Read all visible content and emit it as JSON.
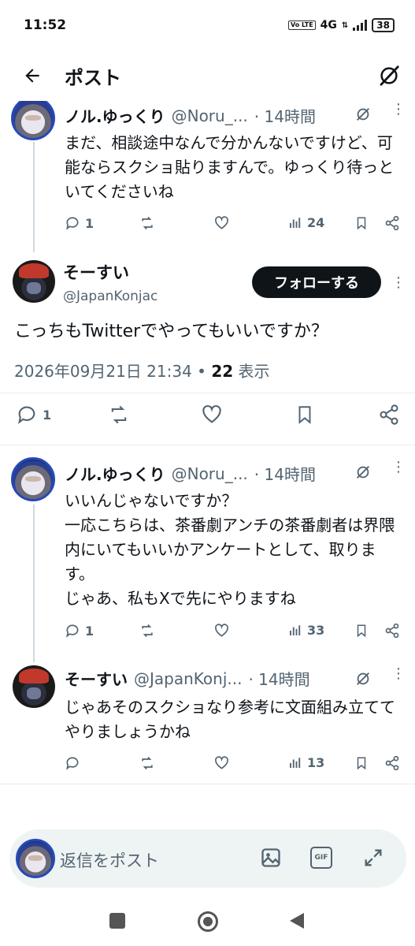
{
  "status_bar": {
    "time": "11:52",
    "network": "4G",
    "volte": "Vo LTE",
    "battery": "38"
  },
  "header": {
    "title": "ポスト"
  },
  "tweets": [
    {
      "name": "ノル.ゆっくり",
      "handle": "@Noru_...",
      "time": "· 14時間",
      "text": "まだ、相談途中なんで分かんないですけど、可能ならスクショ貼りますんで。ゆっくり待っといてくださいね",
      "replies": "1",
      "views": "24"
    },
    {
      "name": "ノル.ゆっくり",
      "handle": "@Noru_...",
      "time": "· 14時間",
      "text": "いいんじゃないですか？\n一応こちらは、茶番劇アンチの茶番劇者は界隈内にいてもいいかアンケートとして、取ります。\nじゃあ、私もXで先にやりますね",
      "replies": "1",
      "views": "33"
    },
    {
      "name": "そーすい",
      "handle": "@JapanKonj...",
      "time": "· 14時間",
      "text": "じゃあそのスクショなり参考に文面組み立ててやりましょうかね",
      "replies": "",
      "views": "13"
    }
  ],
  "focused": {
    "name": "そーすい",
    "handle": "@JapanKonjac",
    "follow_label": "フォローする",
    "text": "こっちもTwitterでやってもいいですか？",
    "timestamp": "2026年09月21日 21:34",
    "dot": " • ",
    "views_count": "22",
    "views_label": " 表示",
    "replies": "1"
  },
  "reply_bar": {
    "placeholder": "返信をポスト",
    "gif_label": "GIF"
  }
}
